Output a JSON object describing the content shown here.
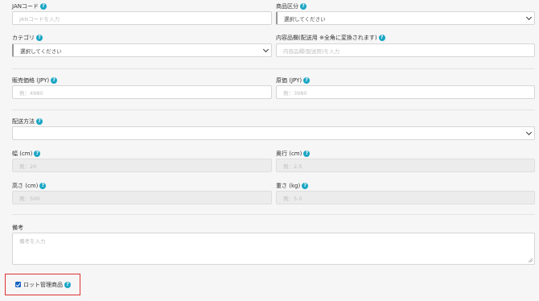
{
  "help_glyph": "?",
  "colors": {
    "help": "#1aa6c4",
    "checkbox": "#1565c0",
    "highlight_border": "#e03232"
  },
  "fields": {
    "jan": {
      "label": "JANコード",
      "placeholder": "JANコードを入力"
    },
    "product_type": {
      "label": "商品区分",
      "value": "選択してください"
    },
    "category": {
      "label": "カテゴリ",
      "value": "選択してください"
    },
    "contents": {
      "label": "内容品欄(配送用 ※全角に変換されます)",
      "placeholder": "内容品欄(配送用)を入力"
    },
    "sale_price": {
      "label": "販売価格 (JPY)",
      "placeholder": "例：4980"
    },
    "cost": {
      "label": "原価 (JPY)",
      "placeholder": "例：3980"
    },
    "shipping": {
      "label": "配送方法",
      "value": ""
    },
    "width": {
      "label": "幅 (cm)",
      "placeholder": "例：20"
    },
    "depth": {
      "label": "奥行 (cm)",
      "placeholder": "例：2.5"
    },
    "height": {
      "label": "高さ (cm)",
      "placeholder": "例：500"
    },
    "weight": {
      "label": "重さ (kg)",
      "placeholder": "例：5.0"
    },
    "notes": {
      "label": "備考",
      "placeholder": "備考を入力"
    }
  },
  "lot_managed": {
    "label": "ロット管理商品",
    "checked": true
  }
}
